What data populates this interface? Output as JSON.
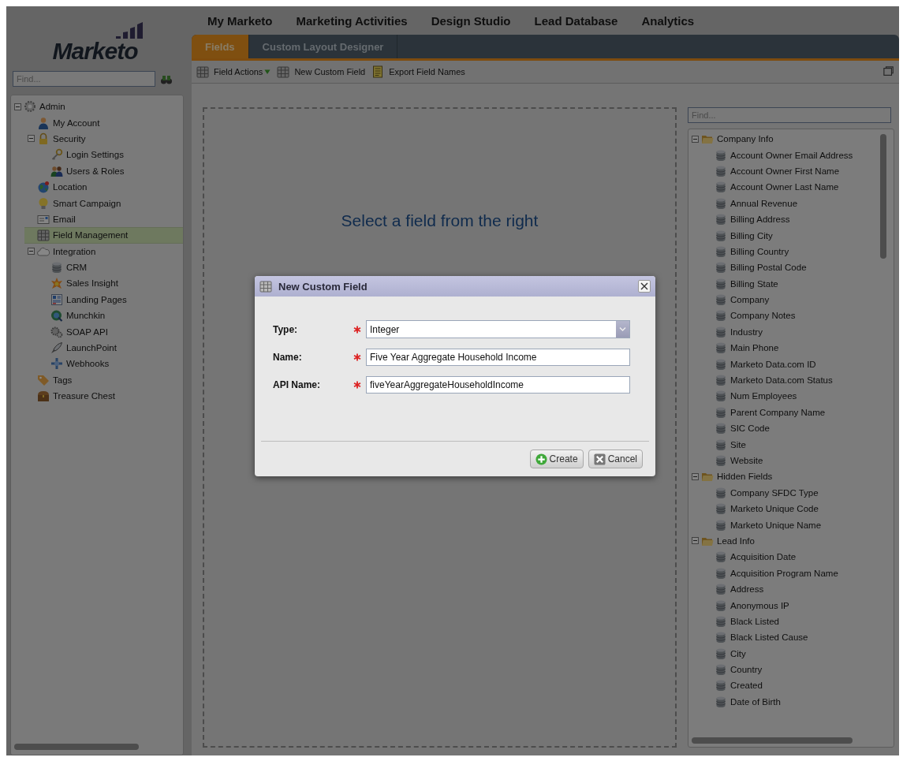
{
  "app": {
    "logo": "Marketo"
  },
  "sidebar": {
    "search": {
      "placeholder": "Find..."
    },
    "tree": [
      {
        "label": "Admin",
        "expanded": true,
        "selected": false,
        "children": [
          {
            "label": "My Account",
            "selected": false
          },
          {
            "label": "Security",
            "expanded": true,
            "selected": false,
            "children": [
              {
                "label": "Login Settings",
                "selected": false
              },
              {
                "label": "Users & Roles",
                "selected": false
              }
            ]
          },
          {
            "label": "Location",
            "selected": false
          },
          {
            "label": "Smart Campaign",
            "selected": false
          },
          {
            "label": "Email",
            "selected": false
          },
          {
            "label": "Field Management",
            "selected": true
          },
          {
            "label": "Integration",
            "expanded": true,
            "selected": false,
            "children": [
              {
                "label": "CRM",
                "selected": false
              },
              {
                "label": "Sales Insight",
                "selected": false
              },
              {
                "label": "Landing Pages",
                "selected": false
              },
              {
                "label": "Munchkin",
                "selected": false
              },
              {
                "label": "SOAP API",
                "selected": false
              },
              {
                "label": "LaunchPoint",
                "selected": false
              },
              {
                "label": "Webhooks",
                "selected": false
              }
            ]
          },
          {
            "label": "Tags",
            "selected": false
          },
          {
            "label": "Treasure Chest",
            "selected": false
          }
        ]
      }
    ]
  },
  "top_nav": [
    {
      "label": "My Marketo"
    },
    {
      "label": "Marketing Activities"
    },
    {
      "label": "Design Studio"
    },
    {
      "label": "Lead Database"
    },
    {
      "label": "Analytics"
    }
  ],
  "tabs": [
    {
      "label": "Fields",
      "selected": true
    },
    {
      "label": "Custom Layout Designer",
      "selected": false
    }
  ],
  "toolbar": [
    {
      "label": "Field Actions",
      "kind": "menu"
    },
    {
      "label": "New Custom Field",
      "kind": "button"
    },
    {
      "label": "Export Field Names",
      "kind": "export"
    }
  ],
  "canvas": {
    "hint": "Select a field from the right"
  },
  "field_panel": {
    "search": {
      "placeholder": "Find..."
    },
    "tree": [
      {
        "label": "Company Info",
        "expanded": true,
        "selected": false,
        "children": [
          {
            "label": "Account Owner Email Address",
            "selected": false
          },
          {
            "label": "Account Owner First Name",
            "selected": false
          },
          {
            "label": "Account Owner Last Name",
            "selected": false
          },
          {
            "label": "Annual Revenue",
            "selected": false
          },
          {
            "label": "Billing Address",
            "selected": false
          },
          {
            "label": "Billing City",
            "selected": false
          },
          {
            "label": "Billing Country",
            "selected": false
          },
          {
            "label": "Billing Postal Code",
            "selected": false
          },
          {
            "label": "Billing State",
            "selected": false
          },
          {
            "label": "Company",
            "selected": false
          },
          {
            "label": "Company Notes",
            "selected": false
          },
          {
            "label": "Industry",
            "selected": false
          },
          {
            "label": "Main Phone",
            "selected": false
          },
          {
            "label": "Marketo Data.com ID",
            "selected": false
          },
          {
            "label": "Marketo Data.com Status",
            "selected": false
          },
          {
            "label": "Num Employees",
            "selected": false
          },
          {
            "label": "Parent Company Name",
            "selected": false
          },
          {
            "label": "SIC Code",
            "selected": false
          },
          {
            "label": "Site",
            "selected": false
          },
          {
            "label": "Website",
            "selected": false
          }
        ]
      },
      {
        "label": "Hidden Fields",
        "expanded": true,
        "selected": false,
        "children": [
          {
            "label": "Company SFDC Type",
            "selected": false
          },
          {
            "label": "Marketo Unique Code",
            "selected": false
          },
          {
            "label": "Marketo Unique Name",
            "selected": false
          }
        ]
      },
      {
        "label": "Lead Info",
        "expanded": true,
        "selected": false,
        "children": [
          {
            "label": "Acquisition Date",
            "selected": false
          },
          {
            "label": "Acquisition Program Name",
            "selected": false
          },
          {
            "label": "Address",
            "selected": false
          },
          {
            "label": "Anonymous IP",
            "selected": false
          },
          {
            "label": "Black Listed",
            "selected": false
          },
          {
            "label": "Black Listed Cause",
            "selected": false
          },
          {
            "label": "City",
            "selected": false
          },
          {
            "label": "Country",
            "selected": false
          },
          {
            "label": "Created",
            "selected": false
          },
          {
            "label": "Date of Birth",
            "selected": false
          }
        ]
      }
    ]
  },
  "dialog": {
    "title": "New Custom Field",
    "fields": [
      {
        "label": "Type:",
        "required": true,
        "kind": "select",
        "value": "Integer"
      },
      {
        "label": "Name:",
        "required": true,
        "kind": "text",
        "value": "Five Year Aggregate Household Income"
      },
      {
        "label": "API Name:",
        "required": true,
        "kind": "text",
        "value": "fiveYearAggregateHouseholdIncome"
      }
    ],
    "buttons": [
      {
        "label": "Create",
        "kind": "create"
      },
      {
        "label": "Cancel",
        "kind": "cancel"
      }
    ]
  }
}
